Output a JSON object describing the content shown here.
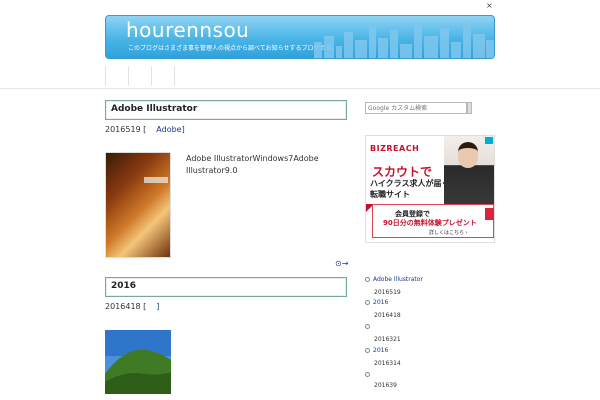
{
  "window": {
    "close_glyph": "×"
  },
  "header": {
    "title": "hourennsou",
    "subtitle": "このブログはさまざま事を管理人の視点から調べてお知らせするブログです。"
  },
  "nav": {
    "items": [
      "",
      "",
      ""
    ]
  },
  "posts": [
    {
      "title": "Adobe Illustrator",
      "date": "2016519 [",
      "category": "Adobe]",
      "excerpt_lines": [
        "Adobe IllustratorWindows7Adobe",
        "Illustrator9.0"
      ],
      "more_glyph": "⊙→"
    },
    {
      "title": "2016",
      "date": "2016418 [",
      "category": "]"
    }
  ],
  "sidebar": {
    "search_placeholder": "Google カスタム検索",
    "ad": {
      "logo": "BIZREACH",
      "headline": "スカウトで",
      "line2": "ハイクラス求人が届く",
      "line3": "転職サイト",
      "box_line1": "会員登録で",
      "box_line2": "90日分の無料体験プレゼント",
      "box_line3": "詳しくはこちら ›"
    },
    "list": [
      {
        "text": "Adobe Illustrator",
        "type": "link"
      },
      {
        "text": "2016519",
        "type": "plain"
      },
      {
        "text": "2016",
        "type": "link"
      },
      {
        "text": "2016418",
        "type": "plain"
      },
      {
        "text": "",
        "type": "bullet-only"
      },
      {
        "text": "2016321",
        "type": "plain"
      },
      {
        "text": "2016",
        "type": "link"
      },
      {
        "text": "2016314",
        "type": "plain"
      },
      {
        "text": "",
        "type": "bullet-only"
      },
      {
        "text": "201639",
        "type": "plain"
      }
    ]
  },
  "colors": {
    "banner": "#49b4e6",
    "link": "#1a3a8a",
    "post_border": "#7aa7a0",
    "ad_red": "#c8102e"
  }
}
